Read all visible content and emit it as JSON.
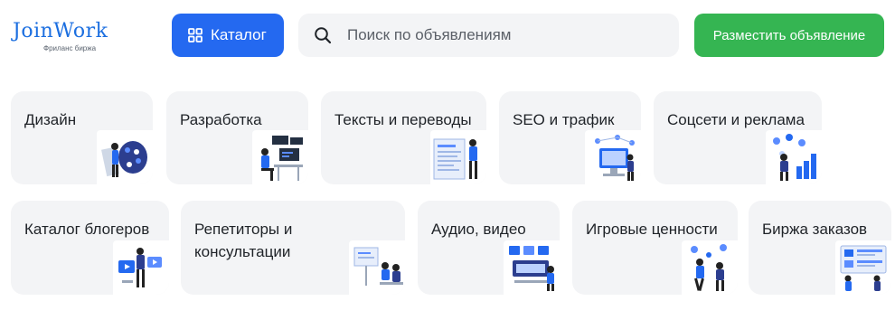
{
  "logo": {
    "name": "JoinWork",
    "subtitle": "Фриланс биржа"
  },
  "header": {
    "catalog_label": "Каталог",
    "search_placeholder": "Поиск по объявлениям",
    "search_value": "",
    "post_button_label": "Разместить объявление"
  },
  "colors": {
    "accent_blue": "#2469f0",
    "accent_green": "#35b552",
    "card_bg": "#f3f4f6"
  },
  "categories": [
    {
      "label": "Дизайн",
      "icon": "design-illustration"
    },
    {
      "label": "Разработка",
      "icon": "development-illustration"
    },
    {
      "label": "Тексты и переводы",
      "icon": "texts-illustration"
    },
    {
      "label": "SEO и трафик",
      "icon": "seo-illustration"
    },
    {
      "label": "Соцсети и реклама",
      "icon": "social-ads-illustration"
    },
    {
      "label": "Каталог блогеров",
      "icon": "bloggers-illustration"
    },
    {
      "label": "Репетиторы и консультации",
      "icon": "tutors-illustration"
    },
    {
      "label": "Аудио, видео",
      "icon": "audio-video-illustration"
    },
    {
      "label": "Игровые ценности",
      "icon": "game-items-illustration"
    },
    {
      "label": "Биржа заказов",
      "icon": "orders-exchange-illustration"
    }
  ]
}
